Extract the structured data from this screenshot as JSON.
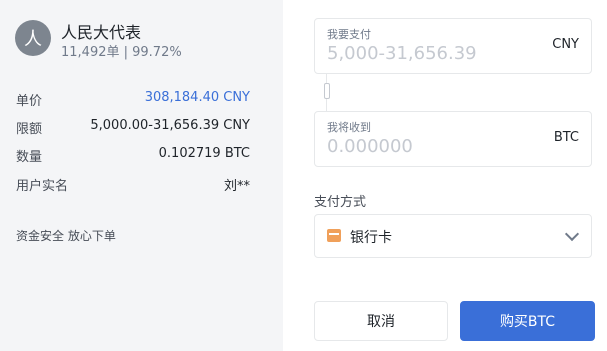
{
  "seller": {
    "avatar_char": "人",
    "name": "人民大代表",
    "stats": "11,492单 | 99.72%"
  },
  "info": [
    {
      "label": "单价",
      "value": "308,184.40 CNY"
    },
    {
      "label": "限额",
      "value": "5,000.00-31,656.39 CNY"
    },
    {
      "label": "数量",
      "value": "0.102719 BTC"
    },
    {
      "label": "用户实名",
      "value": "刘**"
    }
  ],
  "note": "资金安全 放心下单",
  "pay_input": {
    "caption": "我要支付",
    "placeholder": "5,000-31,656.39",
    "unit": "CNY"
  },
  "receive_input": {
    "caption": "我将收到",
    "placeholder": "0.000000",
    "unit": "BTC"
  },
  "payment": {
    "label": "支付方式",
    "selected": "银行卡"
  },
  "buttons": {
    "cancel": "取消",
    "buy": "购买BTC"
  },
  "colors": {
    "accent": "#3a6fd8",
    "bank_card_icon": "#f0a05a"
  }
}
